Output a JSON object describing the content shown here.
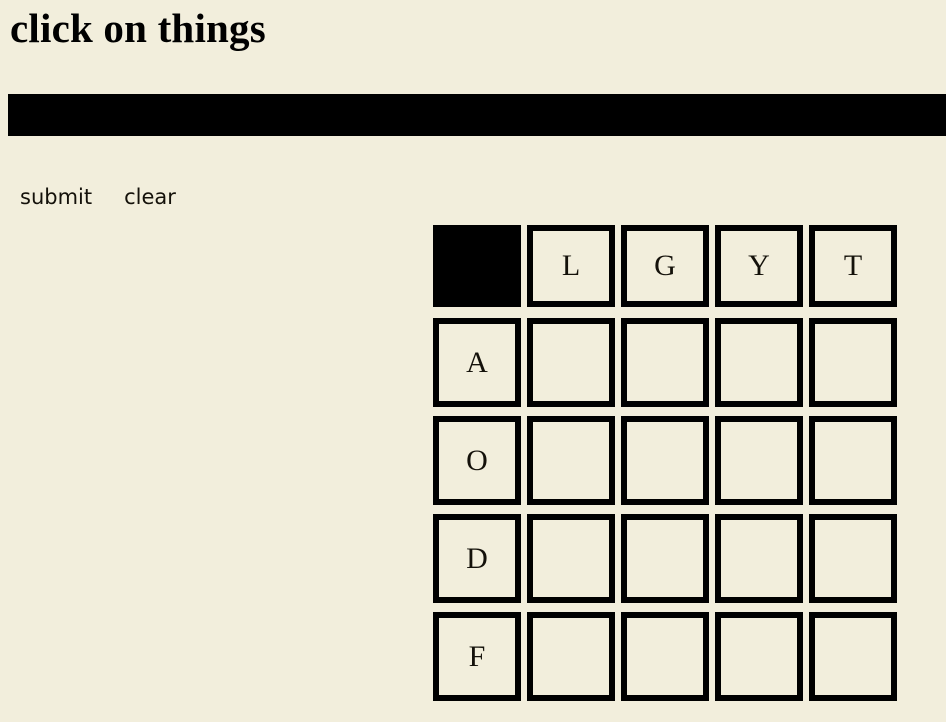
{
  "page": {
    "title": "click on things",
    "background_color": "#F2EEDC",
    "ink_color": "#000000"
  },
  "status_bar": {
    "text": "",
    "color": "#000000"
  },
  "toolbar": {
    "submit_label": "submit",
    "clear_label": "clear"
  },
  "grid": {
    "rows": 5,
    "columns": 5,
    "corner_label": "",
    "column_headers": [
      "L",
      "G",
      "Y",
      "T"
    ],
    "row_headers": [
      "A",
      "O",
      "D",
      "F"
    ],
    "cells": [
      [
        "",
        "",
        "",
        ""
      ],
      [
        "",
        "",
        "",
        ""
      ],
      [
        "",
        "",
        "",
        ""
      ],
      [
        "",
        "",
        "",
        ""
      ]
    ]
  }
}
